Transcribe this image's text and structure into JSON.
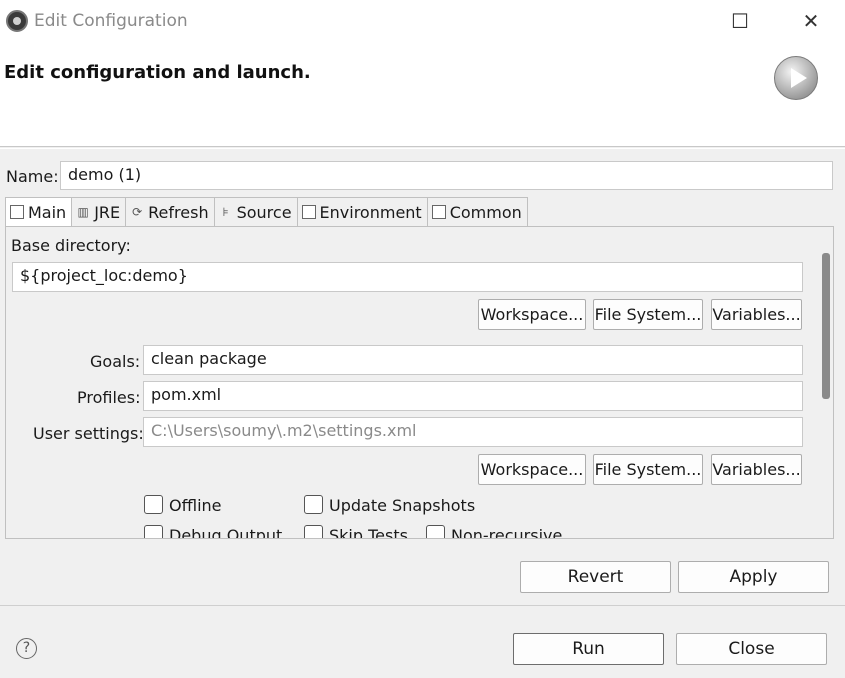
{
  "window": {
    "title": "Edit Configuration",
    "maximize_glyph": "☐",
    "close_glyph": "✕"
  },
  "header": {
    "title": "Edit configuration and launch."
  },
  "name": {
    "label": "Name:",
    "value": "demo (1)"
  },
  "tabs": [
    {
      "label": "Main",
      "icon": "main-tab-icon"
    },
    {
      "label": "JRE",
      "icon": "jre-tab-icon"
    },
    {
      "label": "Refresh",
      "icon": "refresh-tab-icon"
    },
    {
      "label": "Source",
      "icon": "source-tab-icon"
    },
    {
      "label": "Environment",
      "icon": "environment-tab-icon"
    },
    {
      "label": "Common",
      "icon": "common-tab-icon"
    }
  ],
  "main": {
    "base_directory_label": "Base directory:",
    "base_directory_value": "${project_loc:demo}",
    "workspace_button": "Workspace...",
    "filesystem_button": "File System...",
    "variables_button": "Variables...",
    "goals_label": "Goals:",
    "goals_value": "clean package",
    "profiles_label": "Profiles:",
    "profiles_value": "pom.xml",
    "user_settings_label": "User settings:",
    "user_settings_value": "C:\\Users\\soumy\\.m2\\settings.xml",
    "checkboxes": {
      "offline": "Offline",
      "update_snapshots": "Update Snapshots",
      "debug_output": "Debug Output",
      "skip_tests": "Skip Tests",
      "non_recursive": "Non-recursive"
    }
  },
  "actions": {
    "revert": "Revert",
    "apply": "Apply",
    "run": "Run",
    "close": "Close",
    "help_glyph": "?"
  }
}
